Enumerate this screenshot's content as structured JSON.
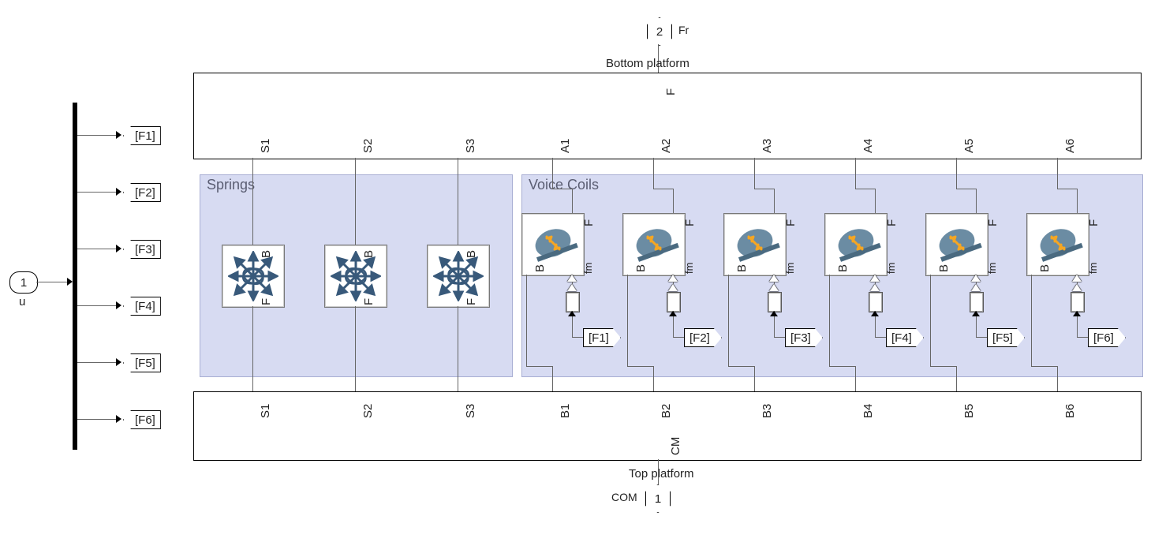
{
  "input_port": {
    "number": "1",
    "name": "u"
  },
  "output_port_top": {
    "number": "2",
    "label": "Fr"
  },
  "output_port_bottom": {
    "number": "1",
    "label": "COM"
  },
  "demux_tags": [
    "[F1]",
    "[F2]",
    "[F3]",
    "[F4]",
    "[F5]",
    "[F6]"
  ],
  "bottom_platform": {
    "title": "Bottom platform",
    "out_port": "F",
    "ports_springs": [
      "S1",
      "S2",
      "S3"
    ],
    "ports_actuators": [
      "A1",
      "A2",
      "A3",
      "A4",
      "A5",
      "A6"
    ]
  },
  "top_platform": {
    "title": "Top platform",
    "out_port": "CM",
    "ports_springs": [
      "S1",
      "S2",
      "S3"
    ],
    "ports_actuators": [
      "B1",
      "B2",
      "B3",
      "B4",
      "B5",
      "B6"
    ]
  },
  "groups": {
    "springs": {
      "title": "Springs",
      "block_labels": {
        "top": "B",
        "bottom": "F"
      },
      "count": 3
    },
    "voice_coils": {
      "title": "Voice Coils",
      "block_labels": {
        "left": "B",
        "right_top": "F",
        "right_bottom": "fm"
      },
      "from_tags": [
        "[F1]",
        "[F2]",
        "[F3]",
        "[F4]",
        "[F5]",
        "[F6]"
      ],
      "count": 6
    }
  }
}
